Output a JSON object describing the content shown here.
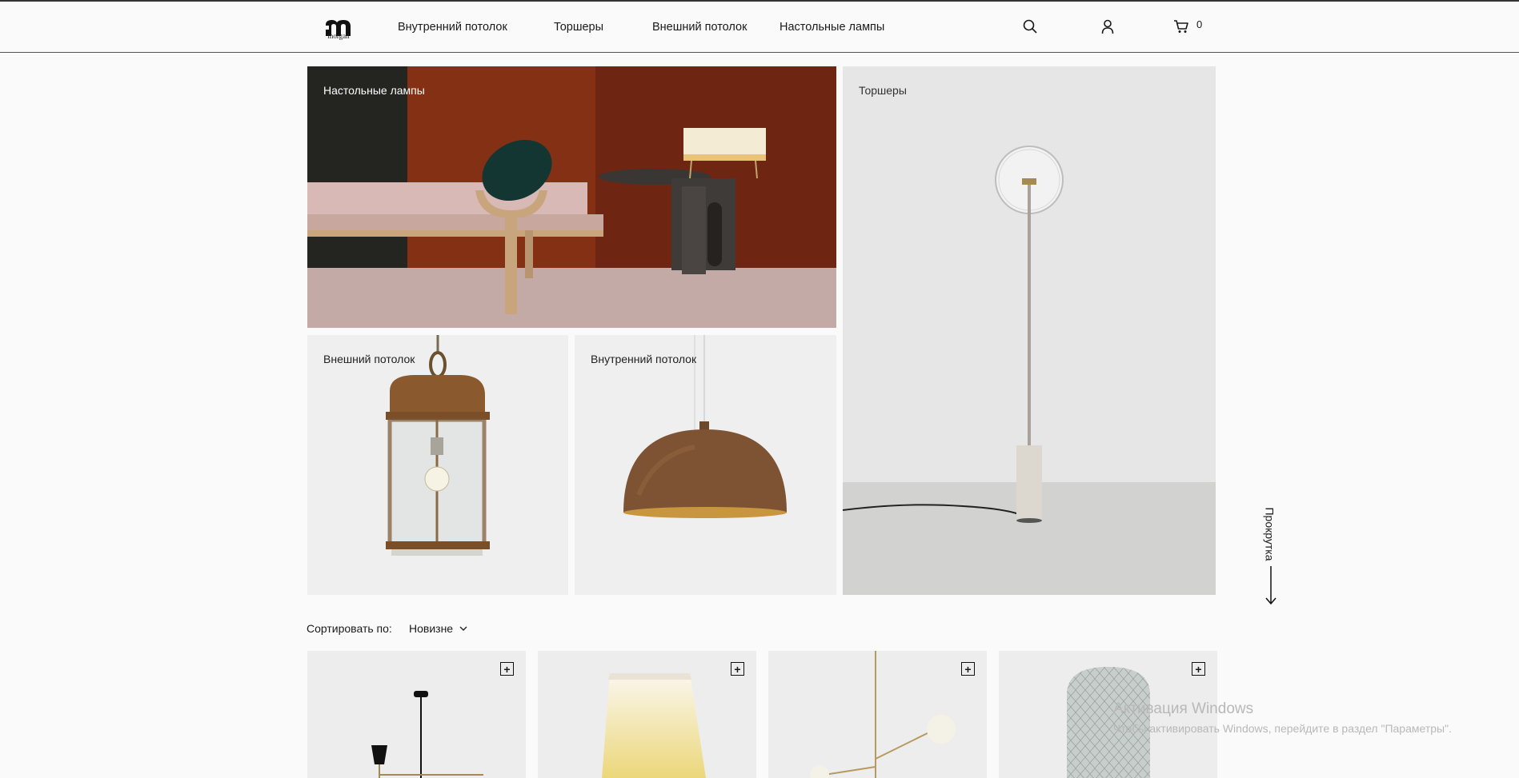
{
  "brand": {
    "logo_text": "morgan",
    "logo_icon": "m-logo-icon"
  },
  "nav": {
    "items": [
      {
        "label": "Внутренний потолок"
      },
      {
        "label": "Торшеры"
      },
      {
        "label": "Внешний потолок"
      },
      {
        "label": "Настольные лампы"
      }
    ]
  },
  "header_icons": {
    "search": "search-icon",
    "account": "user-icon",
    "cart": "cart-icon",
    "cart_count": "0"
  },
  "categories": {
    "table_lamps": "Настольные лампы",
    "floor_lamps": "Торшеры",
    "outdoor_ceiling": "Внешний потолок",
    "indoor_ceiling": "Внутренний потолок"
  },
  "scroll": {
    "label": "Прокрутка",
    "icon": "arrow-down-icon"
  },
  "sort": {
    "label": "Сортировать по:",
    "value": "Новизне",
    "icon": "chevron-down-icon"
  },
  "products": [
    {
      "add_icon": "+"
    },
    {
      "add_icon": "+"
    },
    {
      "add_icon": "+"
    },
    {
      "add_icon": "+"
    }
  ],
  "watermark": {
    "title": "Активация Windows",
    "subtitle": "Чтобы активировать Windows, перейдите в раздел \"Параметры\"."
  },
  "colors": {
    "background": "#fafafa",
    "text": "#1a1a1a",
    "tile_bg": "#ededed",
    "table_wall": "#7a2c16"
  }
}
